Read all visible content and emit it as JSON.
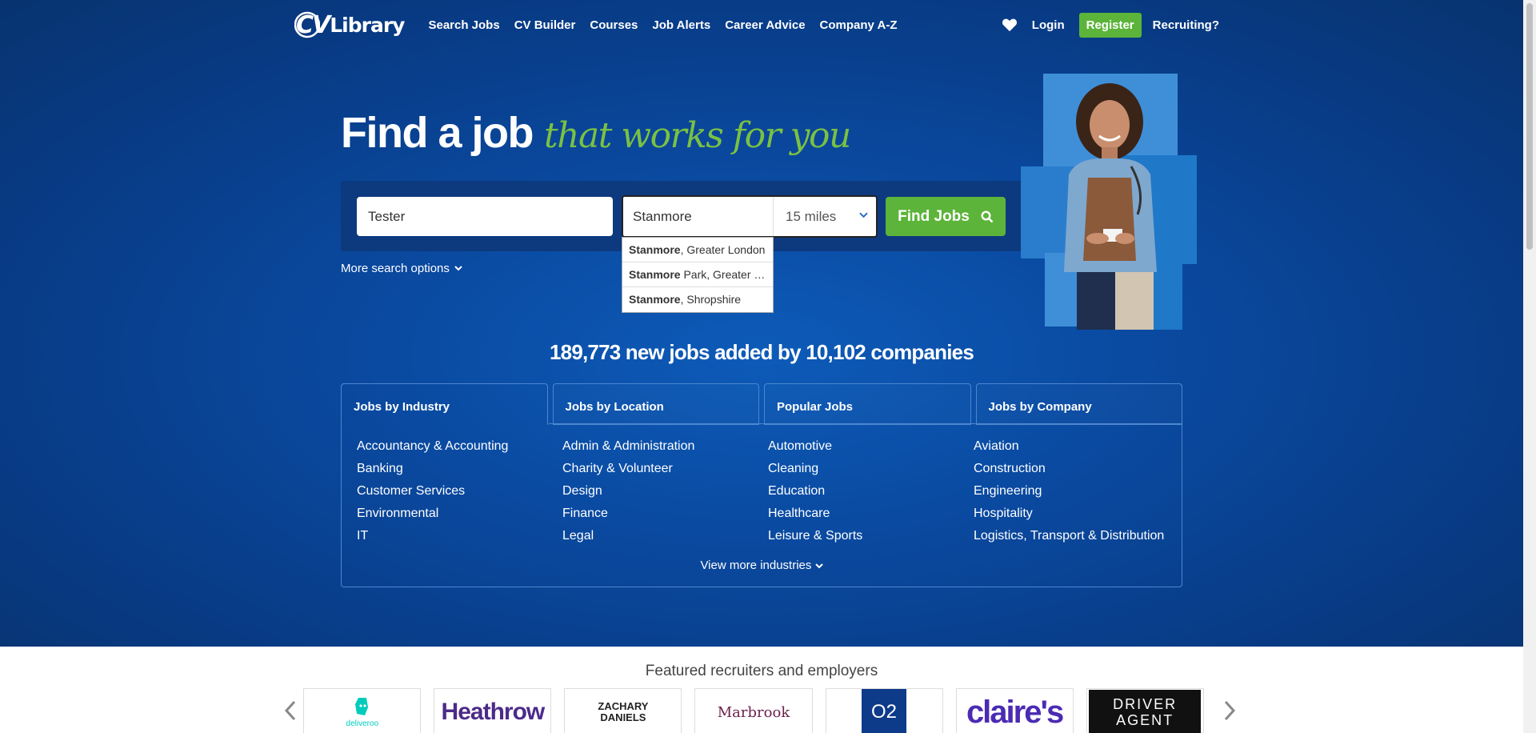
{
  "nav": {
    "logo_cv": "CV",
    "logo_lib": "Library",
    "links": [
      "Search Jobs",
      "CV Builder",
      "Courses",
      "Job Alerts",
      "Career Advice",
      "Company A-Z"
    ],
    "login": "Login",
    "register": "Register",
    "recruiting": "Recruiting?"
  },
  "hero": {
    "title_main": "Find a job",
    "title_accent": "that works for you"
  },
  "search": {
    "keywords_value": "Tester",
    "location_value": "Stanmore",
    "radius_value": "15 miles",
    "button_label": "Find Jobs",
    "more_options": "More search options"
  },
  "autocomplete": [
    {
      "match": "Stanmore",
      "rest": ", Greater London"
    },
    {
      "match": "Stanmore",
      "rest": " Park, Greater London"
    },
    {
      "match": "Stanmore",
      "rest": ", Shropshire"
    }
  ],
  "stats": "189,773 new jobs added by 10,102 companies",
  "tabs": [
    "Jobs by Industry",
    "Jobs by Location",
    "Popular Jobs",
    "Jobs by Company"
  ],
  "industries": [
    "Accountancy & Accounting",
    "Admin & Administration",
    "Automotive",
    "Aviation",
    "Banking",
    "Charity & Volunteer",
    "Cleaning",
    "Construction",
    "Customer Services",
    "Design",
    "Education",
    "Engineering",
    "Environmental",
    "Finance",
    "Healthcare",
    "Hospitality",
    "IT",
    "Legal",
    "Leisure & Sports",
    "Logistics, Transport & Distribution"
  ],
  "view_more": "View more industries",
  "featured": {
    "title": "Featured recruiters and employers",
    "logos": [
      "deliveroo",
      "Heathrow",
      "ZACHARY DANIELS",
      "Marbrook",
      "O2",
      "claire's",
      "DRIVER AGENT"
    ]
  },
  "colors": {
    "brand_blue": "#0a4aa1",
    "accent_green": "#5cb43a",
    "headline_green": "#7ac143"
  }
}
